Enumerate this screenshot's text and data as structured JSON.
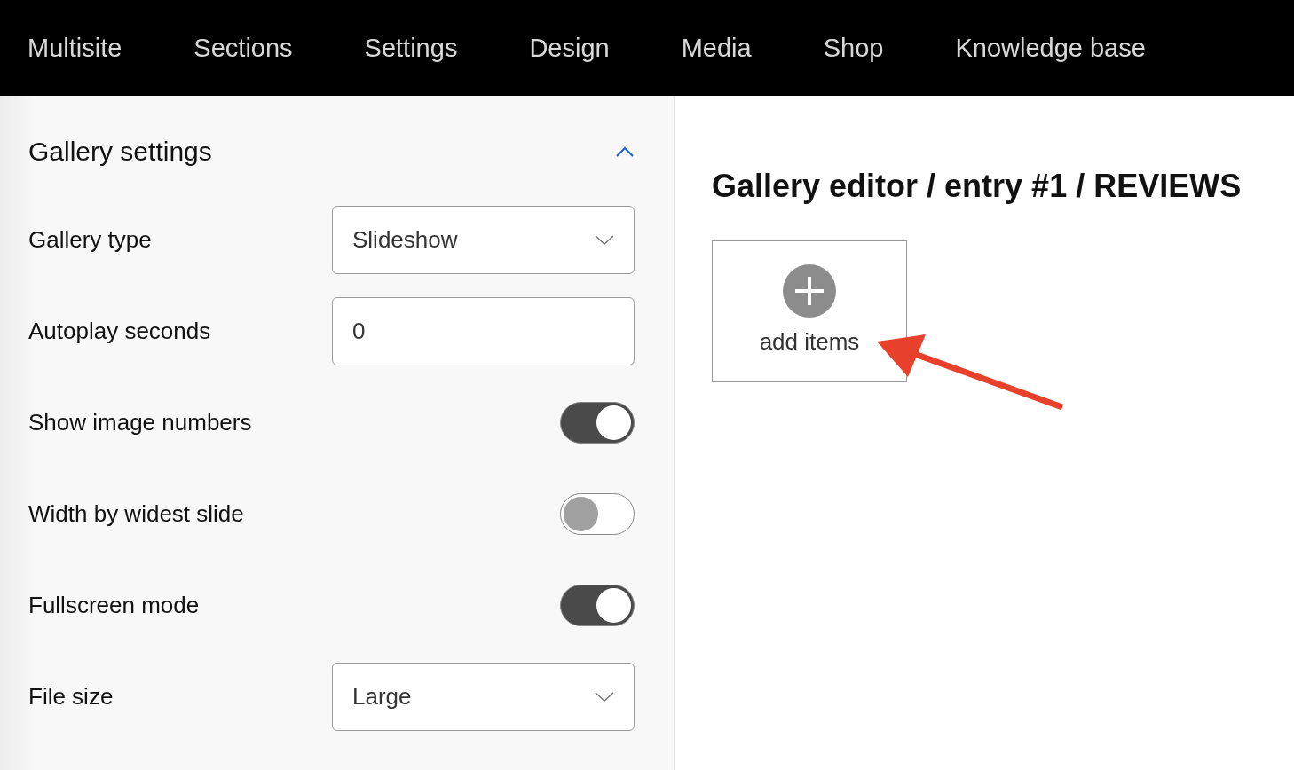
{
  "nav": {
    "items": [
      {
        "label": "Multisite"
      },
      {
        "label": "Sections"
      },
      {
        "label": "Settings"
      },
      {
        "label": "Design"
      },
      {
        "label": "Media"
      },
      {
        "label": "Shop"
      },
      {
        "label": "Knowledge base"
      }
    ]
  },
  "settings": {
    "title": "Gallery settings",
    "expanded": true,
    "rows": [
      {
        "kind": "select",
        "label": "Gallery type",
        "value": "Slideshow"
      },
      {
        "kind": "input",
        "label": "Autoplay seconds",
        "value": "0"
      },
      {
        "kind": "toggle",
        "label": "Show image numbers",
        "on": true
      },
      {
        "kind": "toggle",
        "label": "Width by widest slide",
        "on": false
      },
      {
        "kind": "toggle",
        "label": "Fullscreen mode",
        "on": true
      },
      {
        "kind": "select",
        "label": "File size",
        "value": "Large"
      }
    ]
  },
  "editor": {
    "title": "Gallery editor / entry #1 / REVIEWS",
    "add_label": "add items"
  }
}
